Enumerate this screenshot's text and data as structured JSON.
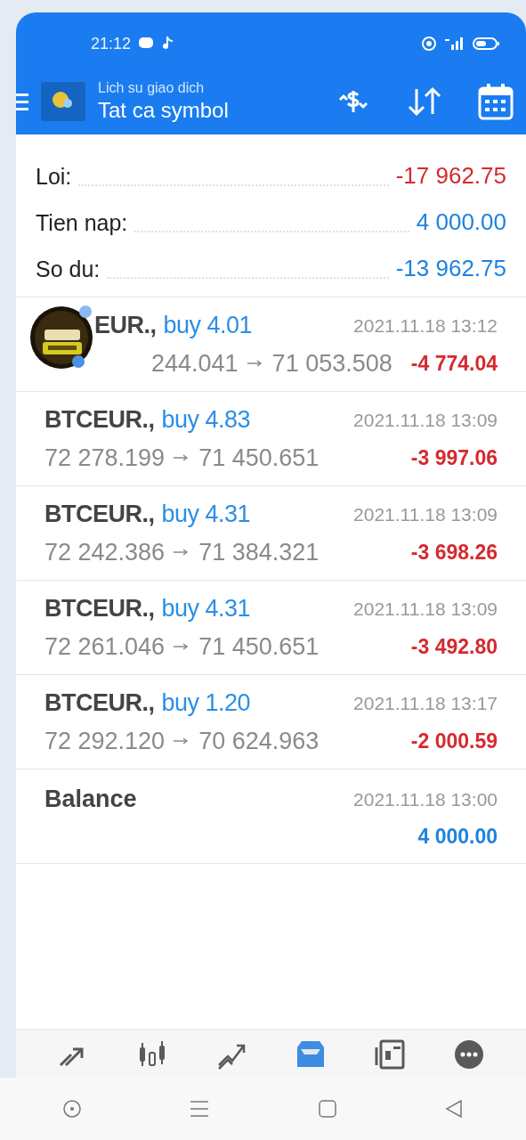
{
  "status_bar": {
    "time": "21:12"
  },
  "header": {
    "subtitle": "Lich su giao dich",
    "title": "Tat ca symbol"
  },
  "summary": [
    {
      "label": "Loi:",
      "value": "-17 962.75",
      "negative": true
    },
    {
      "label": "Tien nap:",
      "value": "4 000.00",
      "negative": false
    },
    {
      "label": "So du:",
      "value": "-13 962.75",
      "negative": false
    }
  ],
  "rows": [
    {
      "kind": "trade",
      "bubble": true,
      "symbol": "EUR.,",
      "type": "buy 4.01",
      "date": "2021.11.18 13:12",
      "price_open": "244.041",
      "price_close": "71 053.508",
      "profit": "-4 774.04"
    },
    {
      "kind": "trade",
      "bubble": false,
      "symbol": "BTCEUR.,",
      "type": "buy 4.83",
      "date": "2021.11.18 13:09",
      "price_open": "72 278.199",
      "price_close": "71 450.651",
      "profit": "-3 997.06"
    },
    {
      "kind": "trade",
      "bubble": false,
      "symbol": "BTCEUR.,",
      "type": "buy 4.31",
      "date": "2021.11.18 13:09",
      "price_open": "72 242.386",
      "price_close": "71 384.321",
      "profit": "-3 698.26"
    },
    {
      "kind": "trade",
      "bubble": false,
      "symbol": "BTCEUR.,",
      "type": "buy 4.31",
      "date": "2021.11.18 13:09",
      "price_open": "72 261.046",
      "price_close": "71 450.651",
      "profit": "-3 492.80"
    },
    {
      "kind": "trade",
      "bubble": false,
      "symbol": "BTCEUR.,",
      "type": "buy 1.20",
      "date": "2021.11.18 13:17",
      "price_open": "72 292.120",
      "price_close": "70 624.963",
      "profit": "-2 000.59"
    },
    {
      "kind": "balance",
      "label": "Balance",
      "date": "2021.11.18 13:00",
      "amount": "4 000.00"
    }
  ],
  "bottom_tabs": [
    {
      "kind": "quotes",
      "selected": false
    },
    {
      "kind": "chart",
      "selected": false
    },
    {
      "kind": "trade",
      "selected": false
    },
    {
      "kind": "history",
      "selected": true
    },
    {
      "kind": "news",
      "selected": false
    },
    {
      "kind": "chat",
      "selected": false
    }
  ]
}
